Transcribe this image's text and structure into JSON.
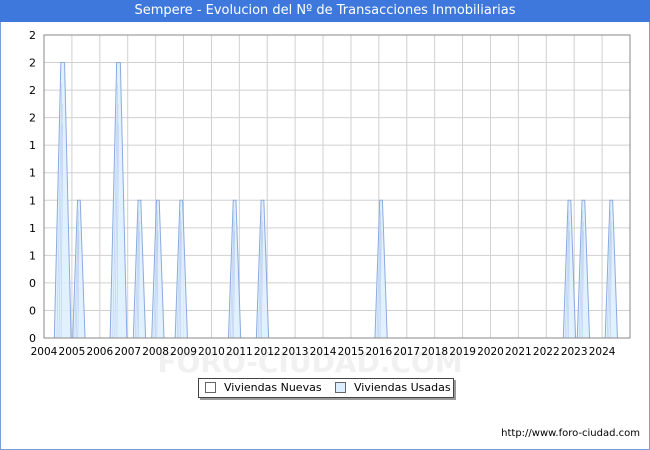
{
  "title": "Sempere - Evolucion del Nº de Transacciones Inmobiliarias",
  "footer_url": "http://www.foro-ciudad.com",
  "watermark": "FORO-CIUDAD.COM",
  "colors": {
    "title_bg": "#3f78dc",
    "nuevas_fill": "#ffffff",
    "usadas_fill": "#ddeeff",
    "usadas_stroke": "#8aabdf",
    "grid": "#d0d0d0"
  },
  "chart_data": {
    "type": "area",
    "title": "Sempere - Evolucion del Nº de Transacciones Inmobiliarias",
    "xlabel": "",
    "ylabel": "",
    "x_ticks": [
      "2004",
      "2005",
      "2006",
      "2007",
      "2008",
      "2009",
      "2010",
      "2011",
      "2012",
      "2013",
      "2014",
      "2015",
      "2016",
      "2017",
      "2018",
      "2019",
      "2020",
      "2021",
      "2022",
      "2023",
      "2024"
    ],
    "y_tick_labels": [
      "0",
      "0",
      "0",
      "1",
      "1",
      "1",
      "1",
      "1",
      "2",
      "2",
      "2",
      "2"
    ],
    "ylim": [
      0,
      2.2
    ],
    "grid": true,
    "legend_position": "bottom",
    "series": [
      {
        "name": "Viviendas Nuevas",
        "points": []
      },
      {
        "name": "Viviendas Usadas",
        "points": [
          {
            "x": 2004.67,
            "y": 2
          },
          {
            "x": 2005.25,
            "y": 1
          },
          {
            "x": 2006.67,
            "y": 2
          },
          {
            "x": 2007.42,
            "y": 1
          },
          {
            "x": 2008.08,
            "y": 1
          },
          {
            "x": 2008.92,
            "y": 1
          },
          {
            "x": 2010.83,
            "y": 1
          },
          {
            "x": 2011.83,
            "y": 1
          },
          {
            "x": 2016.08,
            "y": 1
          },
          {
            "x": 2022.83,
            "y": 1
          },
          {
            "x": 2023.33,
            "y": 1
          },
          {
            "x": 2024.33,
            "y": 1
          }
        ]
      }
    ]
  },
  "legend": {
    "nuevas": "Viviendas Nuevas",
    "usadas": "Viviendas Usadas"
  }
}
